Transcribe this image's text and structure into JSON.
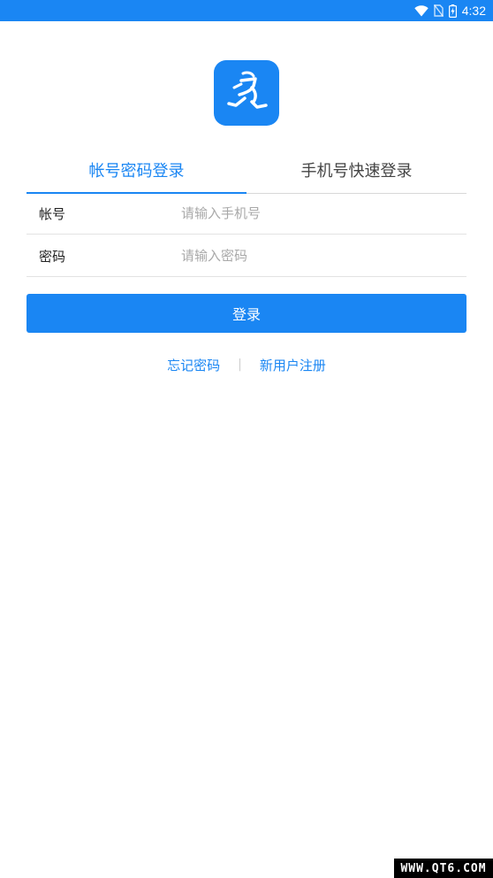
{
  "status_bar": {
    "time": "4:32",
    "background": "#1a86f3",
    "icons": [
      "wifi-icon",
      "no-sim-icon",
      "battery-charging-icon"
    ]
  },
  "app": {
    "logo_icon": "running-courier-logo",
    "brand_color": "#1a86f3"
  },
  "tabs": [
    {
      "label": "帐号密码登录",
      "active": true
    },
    {
      "label": "手机号快速登录",
      "active": false
    }
  ],
  "form": {
    "account": {
      "label": "帐号",
      "value": "",
      "placeholder": "请输入手机号"
    },
    "password": {
      "label": "密码",
      "value": "",
      "placeholder": "请输入密码"
    }
  },
  "login_button": {
    "label": "登录"
  },
  "links": {
    "forgot_password": "忘记密码",
    "divider": "|",
    "register": "新用户注册"
  },
  "watermark": {
    "text": "WWW.QT6.COM"
  }
}
